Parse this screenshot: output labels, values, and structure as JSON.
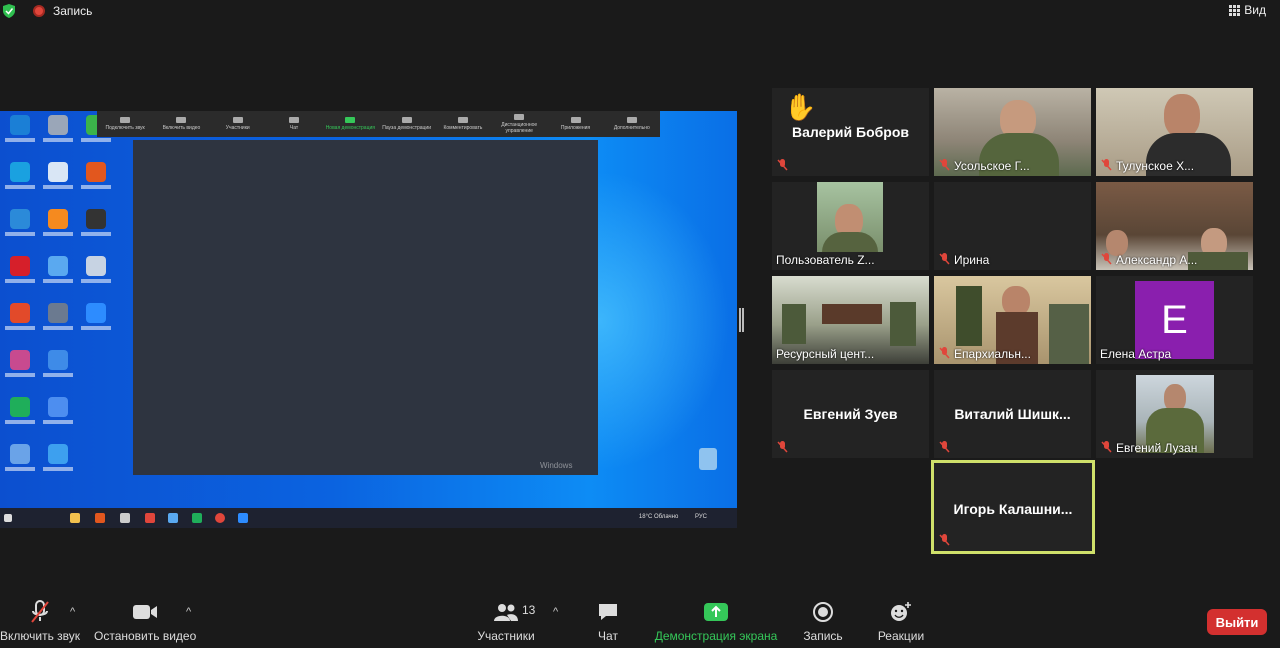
{
  "topbar": {
    "recording_label": "Запись",
    "view_label": "Вид"
  },
  "shared_screen": {
    "toolbar": [
      "Подключить звук",
      "Включить видео",
      "Участники",
      "Чат",
      "Новая демонстрация",
      "Пауза демонстрации",
      "Комментировать",
      "Дистанционное управление",
      "Приложения",
      "Дополнительно"
    ],
    "watermark": "Windows",
    "tray_text": "18°C Облачно",
    "tray_lang": "РУС"
  },
  "participants": [
    {
      "name": "Валерий Бобров",
      "type": "name-only",
      "hand_raised": true
    },
    {
      "name": "Усольское Г...",
      "type": "video"
    },
    {
      "name": "Тулунское Х...",
      "type": "video"
    },
    {
      "name": "Пользователь Z...",
      "type": "video"
    },
    {
      "name": "Ирина",
      "type": "label-only"
    },
    {
      "name": "Александр А...",
      "type": "video"
    },
    {
      "name": "Ресурсный цент...",
      "type": "video"
    },
    {
      "name": "Епархиальн...",
      "type": "video"
    },
    {
      "name": "Елена Астра",
      "type": "avatar",
      "initial": "E"
    },
    {
      "name": "Евгений Зуев",
      "type": "name-only"
    },
    {
      "name": "Виталий  Шишк...",
      "type": "name-only"
    },
    {
      "name": "Евгений Лузан",
      "type": "video"
    },
    {
      "name": "Игорь  Калашни...",
      "type": "name-only",
      "active_speaker": true
    }
  ],
  "bottombar": {
    "unmute": "Включить звук",
    "stop_video": "Остановить видео",
    "participants": "Участники",
    "participants_count": "13",
    "chat": "Чат",
    "share_screen": "Демонстрация экрана",
    "record": "Запись",
    "reactions": "Реакции",
    "leave": "Выйти"
  },
  "colors": {
    "accent_green": "#35c759",
    "leave_red": "#d3302f",
    "active_border": "#cfe06a",
    "avatar_purple": "#8a1fae"
  }
}
